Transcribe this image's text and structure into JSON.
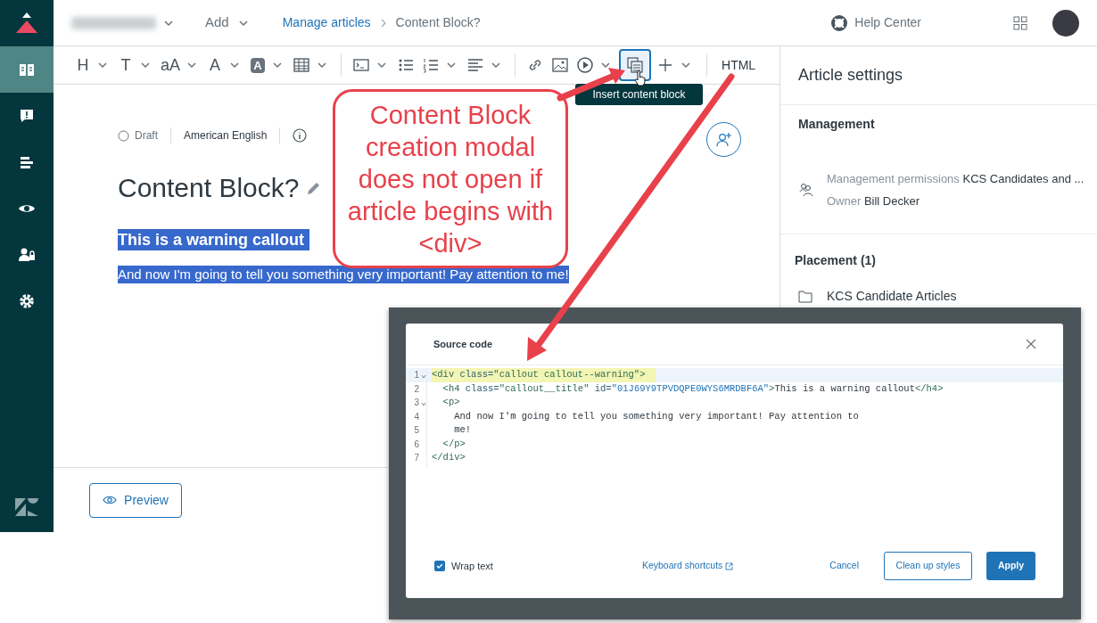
{
  "top_bar": {
    "add_menu": "Add",
    "breadcrumb": [
      {
        "label": "Manage articles",
        "kind": "link"
      },
      {
        "label": "Content Block?",
        "kind": "current"
      }
    ],
    "help_center": "Help Center"
  },
  "sidebar": {
    "items": [
      {
        "selected": true
      },
      {
        "selected": false
      },
      {
        "selected": false
      },
      {
        "selected": false
      },
      {
        "selected": false
      },
      {
        "selected": false
      }
    ]
  },
  "toolbar": {
    "groups": [
      [
        {
          "kind": "glyph",
          "label": "H",
          "dropdown": true,
          "selected": false
        },
        {
          "kind": "glyph",
          "label": "T",
          "dropdown": true,
          "selected": false
        },
        {
          "kind": "glyph",
          "label": "aA",
          "dropdown": true,
          "selected": false
        },
        {
          "kind": "glyph",
          "label": "A",
          "dropdown": true,
          "selected": false
        },
        {
          "kind": "filled_glyph",
          "label": "A",
          "dropdown": true,
          "selected": false
        },
        {
          "kind": "icon",
          "dropdown": true,
          "selected": false
        }
      ],
      [
        {
          "kind": "icon",
          "dropdown": true,
          "selected": false
        },
        {
          "kind": "icon",
          "dropdown": false,
          "selected": false
        },
        {
          "kind": "icon",
          "dropdown": true,
          "selected": false
        },
        {
          "kind": "icon",
          "dropdown": true,
          "selected": false
        }
      ],
      [
        {
          "kind": "icon",
          "dropdown": false,
          "selected": false
        },
        {
          "kind": "icon",
          "dropdown": false,
          "selected": false
        },
        {
          "kind": "icon",
          "dropdown": true,
          "selected": false
        },
        {
          "kind": "icon",
          "dropdown": false,
          "selected": true
        },
        {
          "kind": "icon",
          "dropdown": true,
          "selected": false
        }
      ]
    ],
    "html_button": "HTML",
    "tooltip": "Insert content block"
  },
  "article": {
    "status": "Draft",
    "language": "American English",
    "title": "Content Block?",
    "heading": "This is a warning callout",
    "paragraph": "And now I'm going to tell you something very important! Pay attention to me!",
    "text_selected": true
  },
  "preview_button": "Preview",
  "settings": {
    "title": "Article settings",
    "management": {
      "heading": "Management",
      "permissions_label": "Management permissions",
      "permissions_value": "KCS Candidates and ...",
      "owner_label": "Owner",
      "owner_value": "Bill Decker"
    },
    "placement": {
      "heading": "Placement (1)",
      "item": "KCS Candidate Articles"
    }
  },
  "annotation": {
    "text": "Content Block creation modal does not open if article begins with <div>"
  },
  "modal": {
    "title": "Source code",
    "lines": [
      {
        "number": "1",
        "foldable": true,
        "highlighted": true,
        "tokens": [
          {
            "kind": "tag",
            "text": "<div"
          },
          {
            "kind": "attr",
            "text": " class="
          },
          {
            "kind": "string",
            "text": "\"callout callout--warning\""
          },
          {
            "kind": "tag",
            "text": ">"
          }
        ]
      },
      {
        "number": "2",
        "foldable": false,
        "highlighted": false,
        "tokens": [
          {
            "kind": "tag",
            "text": "  <h4"
          },
          {
            "kind": "attr",
            "text": " class="
          },
          {
            "kind": "string",
            "text": "\"callout__title\""
          },
          {
            "kind": "attr",
            "text": " id="
          },
          {
            "kind": "value",
            "text": "\"01J69Y9TPVDQPE0WYS6MRDBF6A\""
          },
          {
            "kind": "tag",
            "text": ">"
          },
          {
            "kind": "text",
            "text": "This is a warning callout"
          },
          {
            "kind": "tag",
            "text": "</h4>"
          }
        ]
      },
      {
        "number": "3",
        "foldable": true,
        "highlighted": false,
        "tokens": [
          {
            "kind": "tag",
            "text": "  <p>"
          }
        ]
      },
      {
        "number": "4",
        "foldable": false,
        "highlighted": false,
        "tokens": [
          {
            "kind": "text",
            "text": "    And now I'm going to tell you something very important! Pay attention to"
          }
        ]
      },
      {
        "number": "5",
        "foldable": false,
        "highlighted": false,
        "tokens": [
          {
            "kind": "text",
            "text": "    me!"
          }
        ]
      },
      {
        "number": "6",
        "foldable": false,
        "highlighted": false,
        "tokens": [
          {
            "kind": "tag",
            "text": "  </p>"
          }
        ]
      },
      {
        "number": "7",
        "foldable": false,
        "highlighted": false,
        "tokens": [
          {
            "kind": "tag",
            "text": "</div>"
          }
        ]
      }
    ],
    "wrap_text": {
      "label": "Wrap text",
      "checked": true
    },
    "keyboard_shortcuts": "Keyboard shortcuts",
    "cancel": "Cancel",
    "clean_up": "Clean up styles",
    "apply": "Apply"
  }
}
